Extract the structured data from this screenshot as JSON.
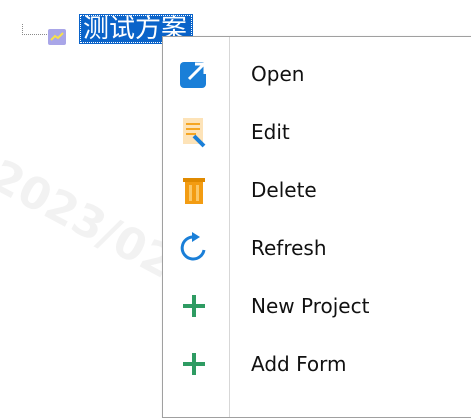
{
  "tree": {
    "node_label": "测试方案",
    "node_icon": "chart-line-icon"
  },
  "menu": {
    "items": [
      {
        "label": "Open",
        "icon": "open-external-icon",
        "color": "#1a7fd8"
      },
      {
        "label": "Edit",
        "icon": "edit-document-icon",
        "color": "#f5a623"
      },
      {
        "label": "Delete",
        "icon": "trash-icon",
        "color": "#f39c12"
      },
      {
        "label": "Refresh",
        "icon": "refresh-icon",
        "color": "#1a7fd8"
      },
      {
        "label": "New Project",
        "icon": "plus-icon",
        "color": "#2e9b62"
      },
      {
        "label": "Add Form",
        "icon": "plus-icon",
        "color": "#2e9b62"
      }
    ]
  },
  "watermark": "2023/02"
}
